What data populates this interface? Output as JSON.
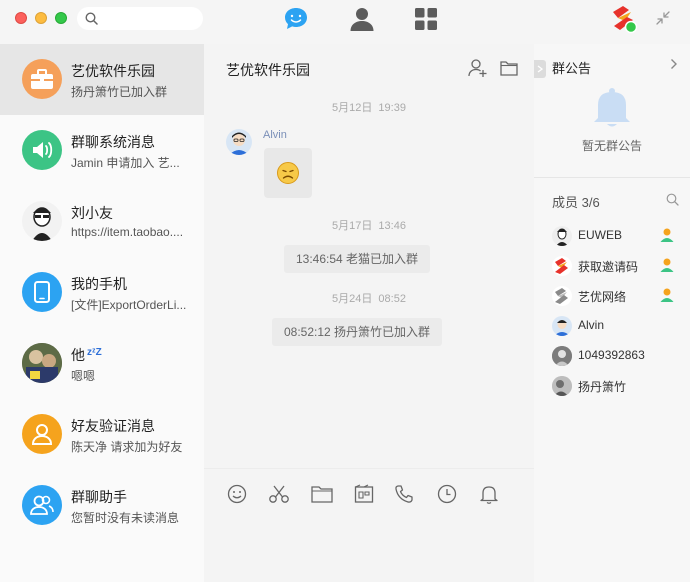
{
  "conversations": [
    {
      "name": "艺优软件乐园",
      "preview": "扬丹箫竹已加入群"
    },
    {
      "name": "群聊系统消息",
      "preview": "Jamin 申请加入 艺..."
    },
    {
      "name": "刘小友",
      "preview": "https://item.taobao...."
    },
    {
      "name": "我的手机",
      "preview": "[文件]ExportOrderLi..."
    },
    {
      "name": "他",
      "preview": "嗯嗯"
    },
    {
      "name": "好友验证消息",
      "preview": "陈天净 请求加为好友"
    },
    {
      "name": "群聊助手",
      "preview": "您暂时没有未读消息"
    }
  ],
  "chat": {
    "title": "艺优软件乐园",
    "timestamps": [
      {
        "date": "5月12日",
        "time": "19:39"
      },
      {
        "date": "5月17日",
        "time": "13:46"
      },
      {
        "date": "5月24日",
        "time": "08:52"
      }
    ],
    "sender": "Alvin",
    "system_messages": [
      "13:46:54 老猫已加入群",
      "08:52:12 扬丹箫竹已加入群"
    ]
  },
  "group_panel": {
    "notice_title": "群公告",
    "notice_empty": "暂无群公告",
    "members_title": "成员 3/6",
    "members": [
      {
        "name": "EUWEB",
        "admin": true
      },
      {
        "name": "获取邀请码",
        "admin": true
      },
      {
        "name": "艺优网络",
        "admin": true
      },
      {
        "name": "Alvin",
        "admin": false
      },
      {
        "name": "1049392863",
        "admin": false
      },
      {
        "name": "扬丹箫竹",
        "admin": false
      }
    ]
  },
  "colors": {
    "accent": "#2ca3f2",
    "orange": "#f5a31d",
    "green": "#3cc485"
  },
  "icons": [
    "search-icon",
    "chat-icon",
    "contacts-icon",
    "apps-icon",
    "app-logo",
    "shrink-icon",
    "add-member-icon",
    "folder-icon",
    "emoji-icon",
    "scissors-icon",
    "file-icon",
    "screen-icon",
    "phone-icon",
    "history-icon",
    "bell-icon",
    "chevron-right-icon"
  ]
}
